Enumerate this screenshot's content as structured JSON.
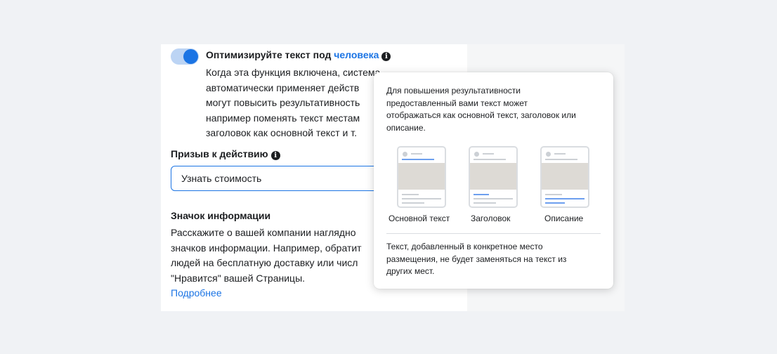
{
  "optimize": {
    "title_prefix": "Оптимизируйте текст под ",
    "title_link": "человека",
    "info_icon": "info-icon",
    "lines": [
      "Когда эта функция включена, система",
      "автоматически применяет действ",
      "могут повысить результативность",
      "например поменять текст местам",
      "заголовок как основной текст и т."
    ],
    "toggle_on": true
  },
  "cta": {
    "label": "Призыв к действию",
    "value": "Узнать стоимость"
  },
  "info_badge": {
    "label": "Значок информации",
    "lines": [
      "Расскажите о вашей компании наглядно",
      "значков информации. Например, обратит",
      "людей на бесплатную доставку или числ",
      "\"Нравится\" вашей Страницы."
    ],
    "learn_more": "Подробнее"
  },
  "tooltip": {
    "intro_lines": [
      "Для повышения результативности",
      "предоставленный вами текст может",
      "отображаться как основной текст, заголовок или",
      "описание."
    ],
    "previews": [
      {
        "label": "Основной текст",
        "highlight": "primary"
      },
      {
        "label": "Заголовок",
        "highlight": "headline"
      },
      {
        "label": "Описание",
        "highlight": "description"
      }
    ],
    "footer_lines": [
      "Текст, добавленный в конкретное место",
      "размещения, не будет заменяться на текст из",
      "других мест."
    ]
  },
  "colors": {
    "accent": "#1b74e4",
    "toggle_track": "#bcd4f4",
    "highlight_bar": "#6d9fef"
  }
}
